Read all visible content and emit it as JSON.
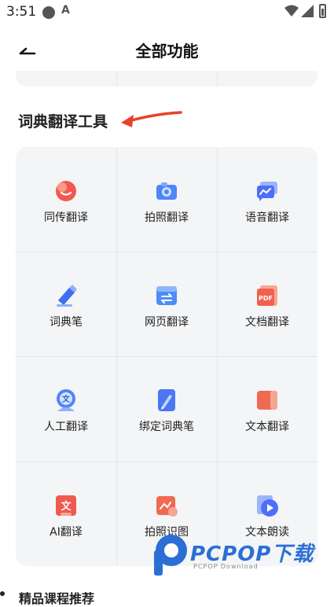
{
  "status_bar": {
    "time": "3:51",
    "a_glyph": "A"
  },
  "header": {
    "title": "全部功能",
    "back_icon": "back-arrow-icon"
  },
  "section": {
    "title": "词典翻译工具"
  },
  "annotation": {
    "color": "#e8412b"
  },
  "tools": [
    {
      "label": "同传翻译",
      "icon": "simultaneous-translation-icon",
      "color": "#f0594f"
    },
    {
      "label": "拍照翻译",
      "icon": "camera-translation-icon",
      "color": "#4f86f7"
    },
    {
      "label": "语音翻译",
      "icon": "voice-translation-icon",
      "color": "#4f6ef7"
    },
    {
      "label": "词典笔",
      "icon": "dictionary-pen-icon",
      "color": "#3d6ff2"
    },
    {
      "label": "网页翻译",
      "icon": "web-translation-icon",
      "color": "#4c8cf7"
    },
    {
      "label": "文档翻译",
      "icon": "pdf-document-icon",
      "color": "#f0604f"
    },
    {
      "label": "人工翻译",
      "icon": "human-translation-icon",
      "color": "#4f86f7"
    },
    {
      "label": "绑定词典笔",
      "icon": "bind-pen-icon",
      "color": "#4c76f2"
    },
    {
      "label": "文本翻译",
      "icon": "text-translation-icon",
      "color": "#f06a52"
    },
    {
      "label": "AI翻译",
      "icon": "ai-translation-icon",
      "color": "#f0594f"
    },
    {
      "label": "拍照识图",
      "icon": "photo-recognition-icon",
      "color": "#f06a52"
    },
    {
      "label": "文本朗读",
      "icon": "text-reading-icon",
      "color": "#4f6ef7"
    }
  ],
  "bottom_section": {
    "title": "精品课程推荐"
  },
  "watermark": {
    "brand": "PCPOP下载",
    "sub": "PCPOP Download"
  }
}
